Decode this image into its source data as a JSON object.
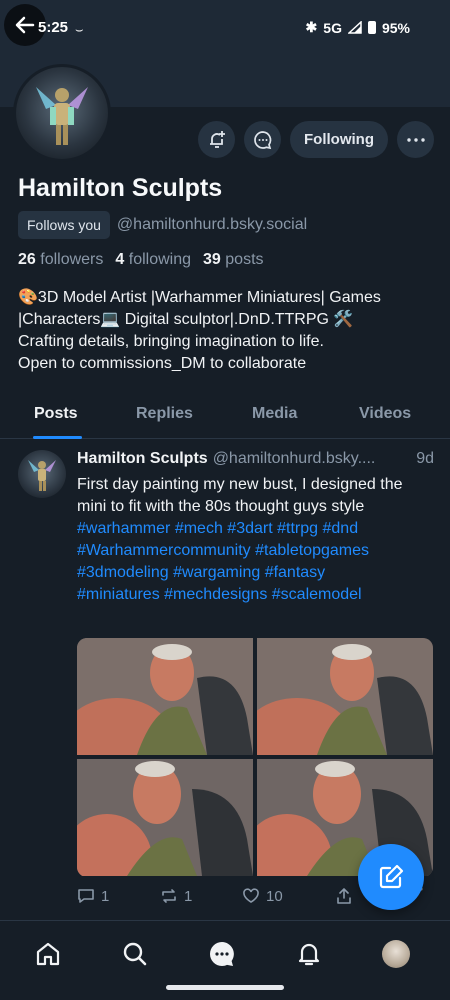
{
  "status": {
    "time": "5:25",
    "network": "5G",
    "battery": "95%"
  },
  "profile": {
    "name": "Hamilton Sculpts",
    "follows_you": "Follows you",
    "handle": "@hamiltonhurd.bsky.social",
    "followers_count": "26",
    "followers_label": "followers",
    "following_count": "4",
    "following_label": "following",
    "posts_count": "39",
    "posts_label": "posts",
    "bio": [
      "🎨3D Model Artist |Warhammer Miniatures| Games",
      "|Characters💻 Digital sculptor|.DnD.TTRPG 🛠️",
      "Crafting details, bringing imagination to life.",
      "Open to commissions_DM to collaborate"
    ],
    "following_button": "Following"
  },
  "tabs": [
    "Posts",
    "Replies",
    "Media",
    "Videos"
  ],
  "active_tab": "Posts",
  "post": {
    "author": "Hamilton Sculpts",
    "handle": "@hamiltonhurd.bsky....",
    "time": "9d",
    "text": "First day painting my new bust, I designed the mini to fit with the 80s thought guys style",
    "hashtags": [
      "#warhammer",
      "#mech",
      "#3dart",
      "#ttrpg",
      "#dnd",
      "#Warhammercommunity",
      "#tabletopgames",
      "#3dmodeling",
      "#wargaming",
      "#fantasy",
      "#miniatures",
      "#mechdesigns",
      "#scalemodel"
    ],
    "reply_count": "1",
    "repost_count": "1",
    "like_count": "10"
  },
  "icons": {
    "back": "arrow-left-icon",
    "notify": "bell-plus-icon",
    "message": "chat-bubble-icon",
    "more": "ellipsis-icon",
    "compose": "edit-icon"
  },
  "colors": {
    "accent": "#208bfe",
    "background": "#161e27",
    "banner": "#1e2936"
  }
}
